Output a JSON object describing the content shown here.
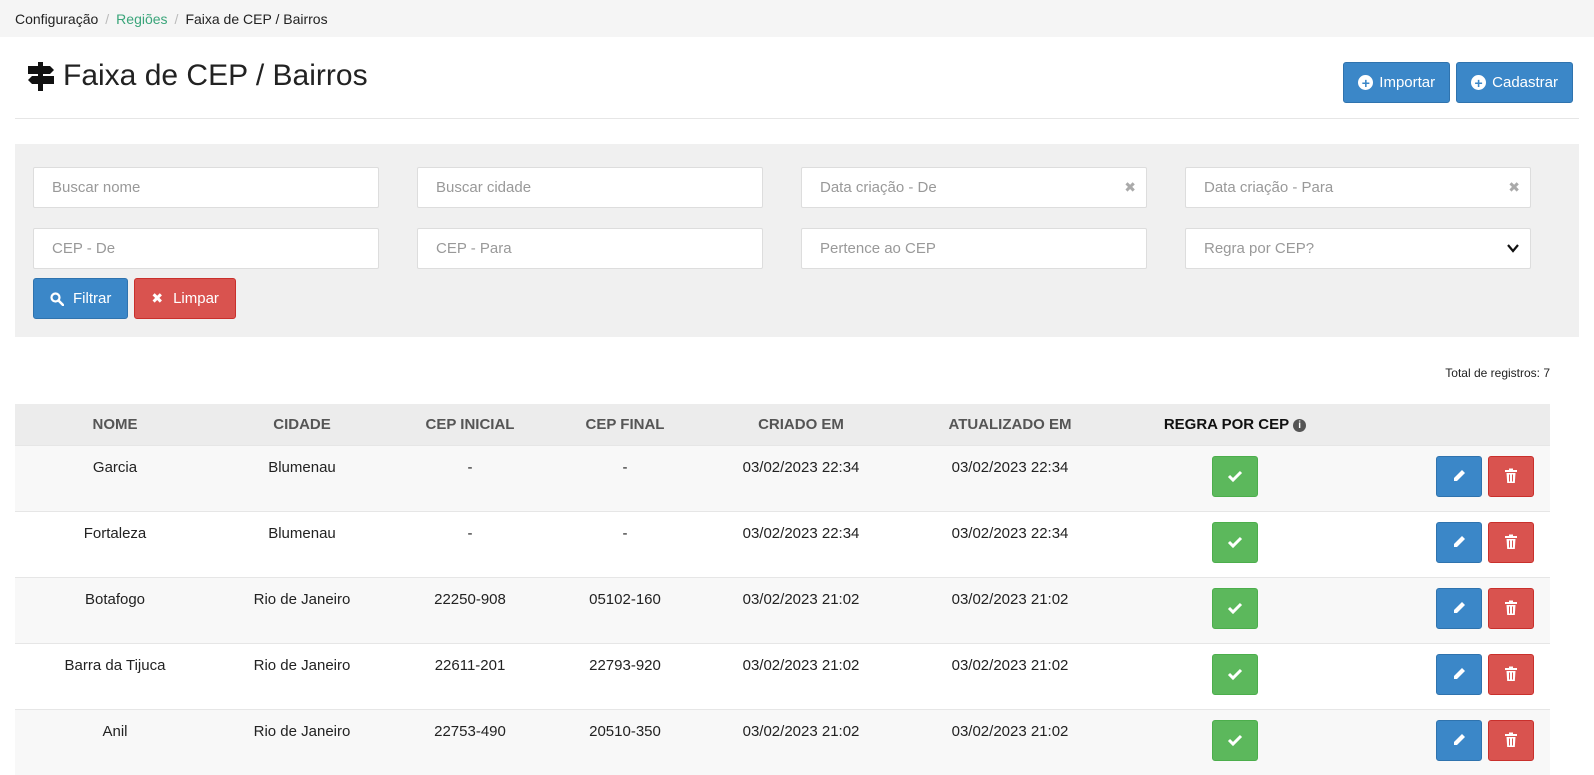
{
  "breadcrumb": {
    "item1": "Configuração",
    "item2": "Regiões",
    "current": "Faixa de CEP / Bairros"
  },
  "page": {
    "title": "Faixa de CEP / Bairros"
  },
  "header_buttons": {
    "import": "Importar",
    "create": "Cadastrar"
  },
  "filters": {
    "nome_placeholder": "Buscar nome",
    "cidade_placeholder": "Buscar cidade",
    "data_de_placeholder": "Data criação - De",
    "data_para_placeholder": "Data criação - Para",
    "cep_de_placeholder": "CEP - De",
    "cep_para_placeholder": "CEP - Para",
    "pertence_placeholder": "Pertence ao CEP",
    "regra_select": "Regra por CEP?",
    "filter_button": "Filtrar",
    "clear_button": "Limpar"
  },
  "total_label": "Total de registros: 7",
  "table": {
    "headers": [
      "NOME",
      "CIDADE",
      "CEP INICIAL",
      "CEP FINAL",
      "CRIADO EM",
      "ATUALIZADO EM",
      "REGRA POR CEP"
    ],
    "rows": [
      {
        "nome": "Garcia",
        "cidade": "Blumenau",
        "cep_inicial": "-",
        "cep_final": "-",
        "criado": "03/02/2023 22:34",
        "atualizado": "03/02/2023 22:34"
      },
      {
        "nome": "Fortaleza",
        "cidade": "Blumenau",
        "cep_inicial": "-",
        "cep_final": "-",
        "criado": "03/02/2023 22:34",
        "atualizado": "03/02/2023 22:34"
      },
      {
        "nome": "Botafogo",
        "cidade": "Rio de Janeiro",
        "cep_inicial": "22250-908",
        "cep_final": "05102-160",
        "criado": "03/02/2023 21:02",
        "atualizado": "03/02/2023 21:02"
      },
      {
        "nome": "Barra da Tijuca",
        "cidade": "Rio de Janeiro",
        "cep_inicial": "22611-201",
        "cep_final": "22793-920",
        "criado": "03/02/2023 21:02",
        "atualizado": "03/02/2023 21:02"
      },
      {
        "nome": "Anil",
        "cidade": "Rio de Janeiro",
        "cep_inicial": "22753-490",
        "cep_final": "20510-350",
        "criado": "03/02/2023 21:02",
        "atualizado": "03/02/2023 21:02"
      }
    ]
  },
  "colors": {
    "primary": "#3b87c8",
    "danger": "#d9534f",
    "success": "#5cb85c",
    "link": "#3aa57a"
  },
  "icons": {
    "title": "signpost-icon",
    "import": "plus-circle-icon",
    "create": "plus-circle-icon",
    "filter": "search-icon",
    "clear": "close-icon",
    "rule": "check-icon",
    "edit": "pencil-icon",
    "delete": "trash-icon",
    "info": "info-icon"
  }
}
